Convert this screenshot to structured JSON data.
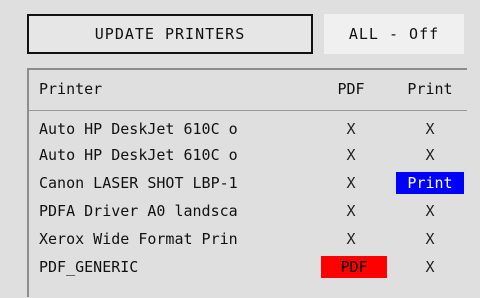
{
  "toolbar": {
    "update_label": "UPDATE PRINTERS",
    "all_label": "ALL - Off"
  },
  "table": {
    "headers": {
      "printer": "Printer",
      "pdf": "PDF",
      "print": "Print"
    },
    "rows": [
      {
        "name": "Auto HP DeskJet 610C o",
        "pdf": "X",
        "print": "X"
      },
      {
        "name": "Auto HP DeskJet 610C o",
        "pdf": "X",
        "print": "X"
      },
      {
        "name": "Canon LASER SHOT LBP-1",
        "pdf": "X",
        "print": "Print"
      },
      {
        "name": "PDFA Driver A0 landsca",
        "pdf": "X",
        "print": "X"
      },
      {
        "name": "Xerox Wide Format Prin",
        "pdf": "X",
        "print": "X"
      },
      {
        "name": "PDF_GENERIC",
        "pdf": "PDF",
        "print": "X"
      }
    ]
  },
  "colors": {
    "print_active": "#0000ff",
    "pdf_active": "#ff0000",
    "background": "#dedfde"
  }
}
